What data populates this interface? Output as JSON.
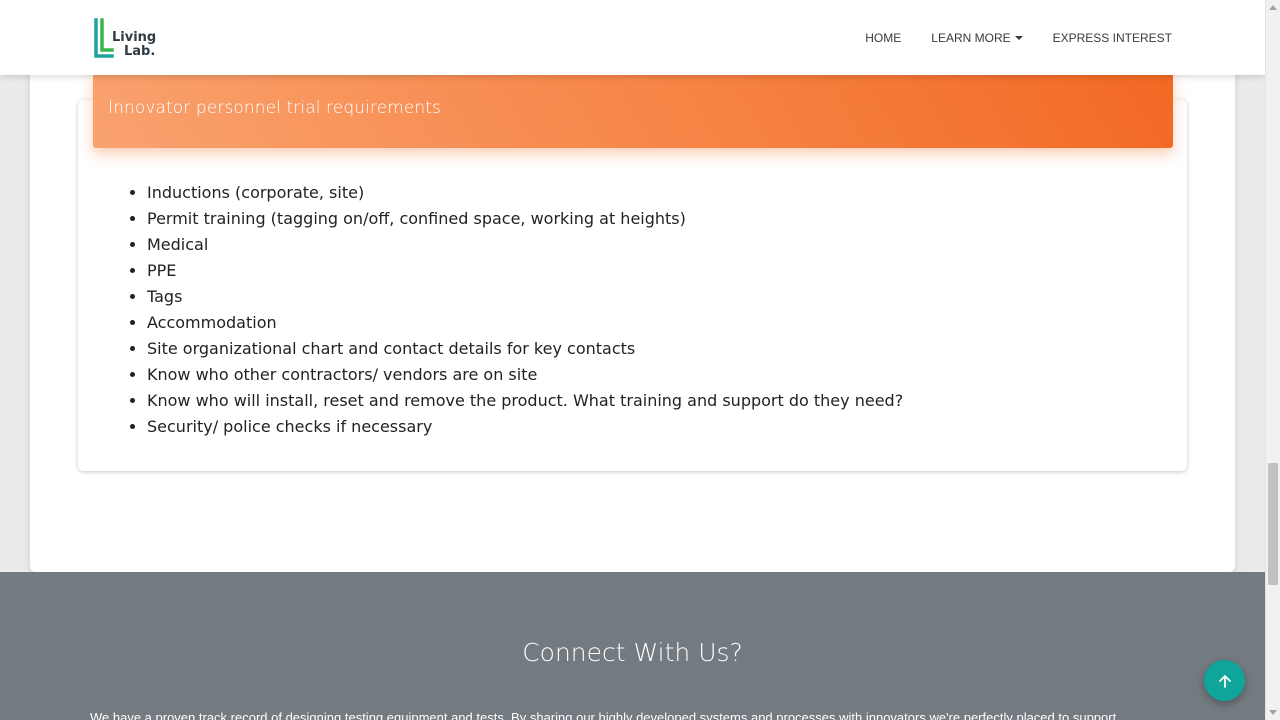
{
  "brand": {
    "logo_line1": "Living",
    "logo_line2": "Lab.",
    "colors": {
      "green": "#38b54a",
      "teal": "#1aa59c",
      "text": "#2f3b45"
    }
  },
  "nav": {
    "items": [
      {
        "label": "HOME",
        "icon": null
      },
      {
        "label": "LEARN MORE",
        "icon": "caret-down-icon"
      },
      {
        "label": "EXPRESS INTEREST",
        "icon": null
      }
    ]
  },
  "card": {
    "title": "Innovator personnel trial requirements",
    "header_colors": [
      "#f9a26f",
      "#f26823"
    ],
    "items": [
      "Inductions (corporate, site)",
      "Permit training (tagging on/off, confined space, working at heights)",
      "Medical",
      "PPE",
      "Tags",
      "Accommodation",
      "Site organizational chart and contact details for key contacts",
      "Know who other contractors/ vendors are on site",
      "Know who will install, reset and remove the product. What training and support do they need?",
      "Security/ police checks if necessary"
    ]
  },
  "footer": {
    "title": "Connect With Us?",
    "text": "We have a proven track record of designing testing equipment and tests. By sharing our highly developed systems and processes with innovators we're perfectly placed to support",
    "background": "#737a80"
  },
  "back_to_top": {
    "icon": "arrow-up-icon",
    "color": "#0fa59a"
  }
}
